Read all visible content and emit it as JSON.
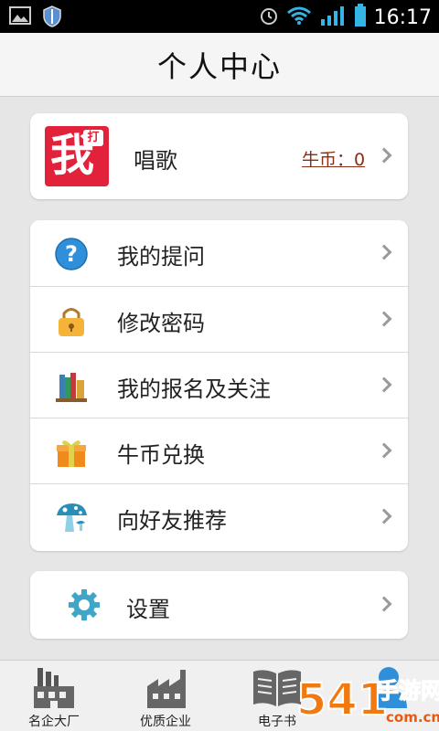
{
  "status_bar": {
    "time": "16:17",
    "icons": [
      "image-icon",
      "shield-icon",
      "alarm-icon",
      "wifi-icon",
      "signal-icon",
      "battery-icon"
    ]
  },
  "header": {
    "title": "个人中心"
  },
  "profile": {
    "avatar_text": "我",
    "avatar_badge": "打",
    "name": "唱歌",
    "coins_label": "牛币：0"
  },
  "menu": {
    "items": [
      {
        "label": "我的提问",
        "icon": "question-icon"
      },
      {
        "label": "修改密码",
        "icon": "lock-icon"
      },
      {
        "label": "我的报名及关注",
        "icon": "books-icon"
      },
      {
        "label": "牛币兑换",
        "icon": "gift-icon"
      },
      {
        "label": "向好友推荐",
        "icon": "mushroom-icon"
      }
    ]
  },
  "settings": {
    "label": "设置",
    "icon": "gear-icon"
  },
  "tabs": [
    {
      "label": "名企大厂",
      "icon": "factory-icon"
    },
    {
      "label": "优质企业",
      "icon": "building-icon"
    },
    {
      "label": "电子书",
      "icon": "book-icon"
    },
    {
      "label": "",
      "icon": "person-icon"
    }
  ],
  "watermark": {
    "text": "手游网",
    "number": "541",
    "domain": "com.cn"
  },
  "colors": {
    "accent_red": "#e2223a",
    "coins": "#8b2d14",
    "background": "#e6e6e6"
  }
}
